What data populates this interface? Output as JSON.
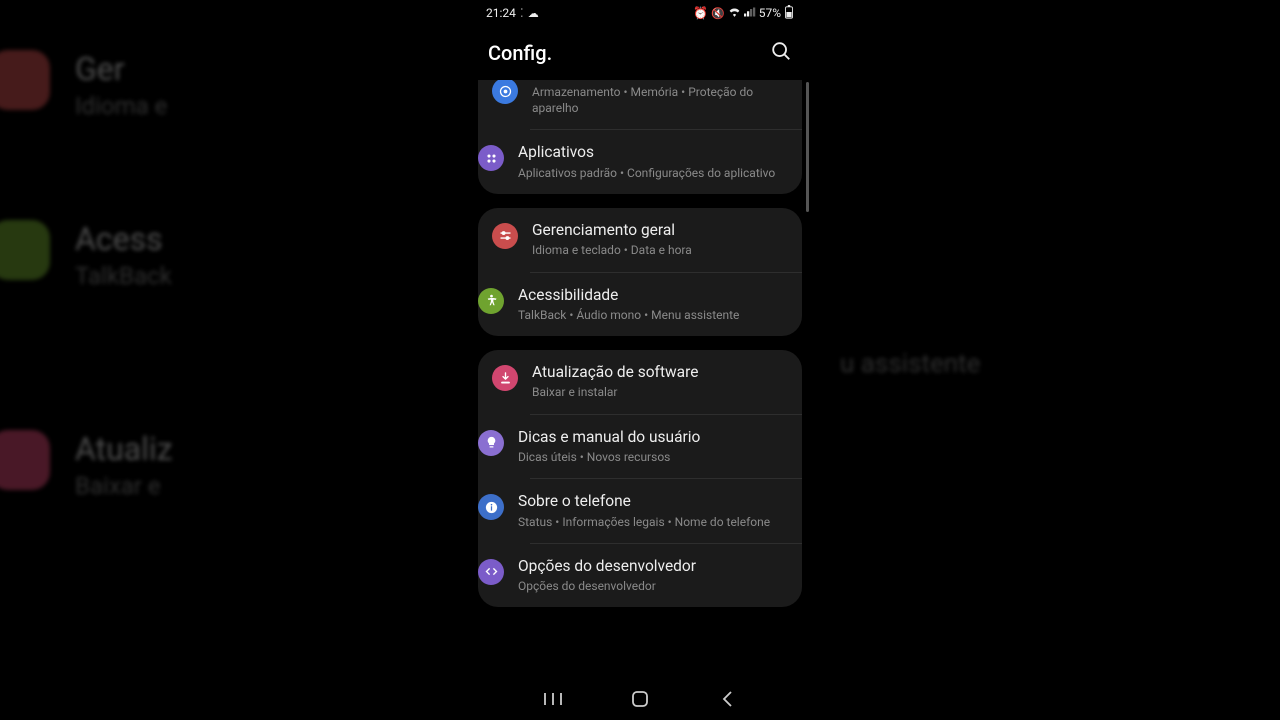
{
  "status": {
    "time": "21:24",
    "battery": "57%"
  },
  "header": {
    "title": "Config."
  },
  "bg": {
    "left": [
      {
        "title": "Ger",
        "sub": "Idioma e"
      },
      {
        "title": "Acess",
        "sub": "TalkBack"
      },
      {
        "title": "Atualiz",
        "sub": "Baixar e"
      }
    ],
    "right": [
      {
        "sub": "u assistente"
      }
    ]
  },
  "groups": [
    {
      "partial": true,
      "items": [
        {
          "icon": "device-care",
          "color": "c-blue",
          "title": "",
          "sub": "Armazenamento  •  Memória  •  Proteção do aparelho"
        },
        {
          "icon": "apps",
          "color": "c-purple",
          "title": "Aplicativos",
          "sub": "Aplicativos padrão  •  Configurações do aplicativo"
        }
      ]
    },
    {
      "items": [
        {
          "icon": "sliders",
          "color": "c-red",
          "title": "Gerenciamento geral",
          "sub": "Idioma e teclado  •  Data e hora"
        },
        {
          "icon": "accessibility",
          "color": "c-green",
          "title": "Acessibilidade",
          "sub": "TalkBack  •  Áudio mono  •  Menu assistente"
        }
      ]
    },
    {
      "items": [
        {
          "icon": "download",
          "color": "c-pink",
          "title": "Atualização de software",
          "sub": "Baixar e instalar"
        },
        {
          "icon": "bulb",
          "color": "c-lav",
          "title": "Dicas e manual do usuário",
          "sub": "Dicas úteis  •  Novos recursos"
        },
        {
          "icon": "info",
          "color": "c-blue2",
          "title": "Sobre o telefone",
          "sub": "Status  •  Informações legais  •  Nome do telefone"
        },
        {
          "icon": "dev",
          "color": "c-vio",
          "title": "Opções do desenvolvedor",
          "sub": "Opções do desenvolvedor"
        }
      ]
    }
  ]
}
